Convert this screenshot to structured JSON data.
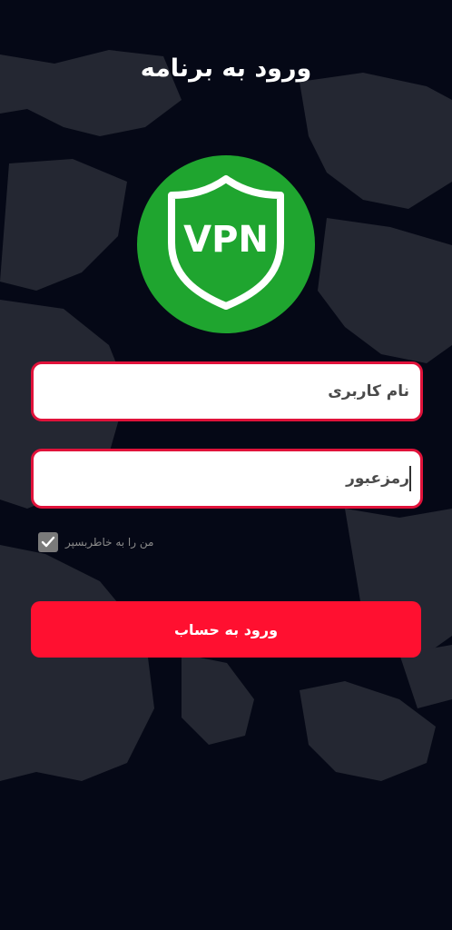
{
  "header": {
    "title": "ورود به برنامه"
  },
  "logo": {
    "text": "VPN",
    "icon": "vpn-shield-icon",
    "background_color": "#1fa52f"
  },
  "form": {
    "username": {
      "placeholder": "نام کاربری",
      "value": ""
    },
    "password": {
      "placeholder": "رمزعبور",
      "value": ""
    },
    "remember_me": {
      "label": "من را به خاطربسپر",
      "checked": true,
      "icon": "check-icon"
    },
    "submit_label": "ورود به حساب"
  },
  "colors": {
    "background": "#050816",
    "accent": "#ff1030",
    "field_border": "#e0123a",
    "logo_green": "#1fa52f"
  }
}
